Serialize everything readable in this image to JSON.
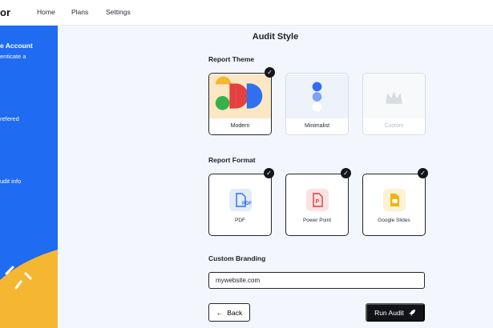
{
  "nav": {
    "brand_fragment": "or",
    "links": [
      "Home",
      "Plans",
      "Settings"
    ]
  },
  "sidebar": {
    "title_fragment": "e Account",
    "subtitle_fragment": "enticate a",
    "step2_fragment": "refered",
    "step3_fragment": "udit info",
    "panel_color": "#1f6bf2",
    "wave_color": "#f5b731"
  },
  "main": {
    "title": "Audit Style",
    "report_theme": {
      "label": "Report Theme",
      "options": [
        {
          "label": "Modern",
          "selected": true
        },
        {
          "label": "Minimalist",
          "selected": false
        },
        {
          "label": "Custom",
          "selected": false,
          "disabled": true
        }
      ]
    },
    "report_format": {
      "label": "Report Format",
      "options": [
        {
          "label": "PDF",
          "icon": "pdf-file-icon",
          "selected": true
        },
        {
          "label": "Power Point",
          "icon": "powerpoint-file-icon",
          "selected": true
        },
        {
          "label": "Google Slides",
          "icon": "google-slides-icon",
          "selected": true
        }
      ]
    },
    "custom_branding": {
      "label": "Custom Branding",
      "value": "mywebsite.com"
    },
    "buttons": {
      "back": "Back",
      "run": "Run Audit"
    }
  },
  "colors": {
    "accent_dark": "#121318",
    "pdf_blue": "#2f6ff0",
    "ppt_red": "#e23b3b",
    "slides_yellow": "#f3b313"
  }
}
